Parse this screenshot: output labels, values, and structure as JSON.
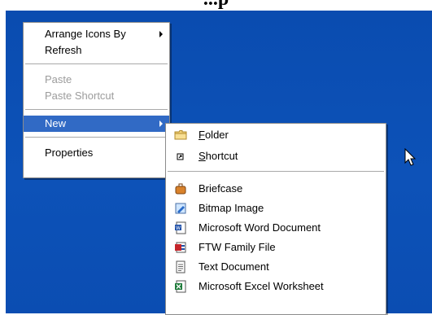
{
  "page_title": "...p",
  "context_menu": {
    "items": [
      {
        "label": "Arrange Icons By",
        "has_submenu": true
      },
      {
        "label": "Refresh"
      },
      {
        "label": "Paste",
        "disabled": true
      },
      {
        "label": "Paste Shortcut",
        "disabled": true
      },
      {
        "label": "New",
        "has_submenu": true,
        "selected": true
      },
      {
        "label": "Properties"
      }
    ]
  },
  "new_submenu": {
    "items": [
      {
        "label_prefix": "",
        "label_key": "F",
        "label_rest": "older",
        "icon": "folder-icon"
      },
      {
        "label_prefix": "",
        "label_key": "S",
        "label_rest": "hortcut",
        "icon": "shortcut-icon"
      },
      {
        "label": "Briefcase",
        "icon": "briefcase-icon"
      },
      {
        "label": "Bitmap Image",
        "icon": "bitmap-image-icon"
      },
      {
        "label": "Microsoft Word Document",
        "icon": "word-document-icon"
      },
      {
        "label": "FTW Family File",
        "icon": "ftw-family-file-icon"
      },
      {
        "label": "Text Document",
        "icon": "text-document-icon"
      },
      {
        "label": "Microsoft Excel Worksheet",
        "icon": "excel-worksheet-icon"
      }
    ]
  },
  "colors": {
    "desktop": "#0d4fb3",
    "highlight": "#316ac5",
    "disabled_text": "#9c9c9c"
  }
}
